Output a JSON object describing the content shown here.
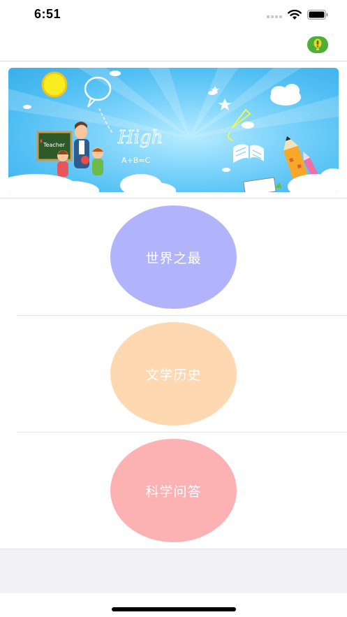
{
  "status_bar": {
    "time": "6:51"
  },
  "nav": {
    "action_icon": "exclamation-icon",
    "action_color": "#4caf38"
  },
  "banner": {
    "chalkboard_text": "Teacher",
    "sky_text_1": "High",
    "sky_text_2": "A+B=C"
  },
  "categories": [
    {
      "label": "世界之最",
      "color": "#b1b3fb"
    },
    {
      "label": "文学历史",
      "color": "#fdd8b1"
    },
    {
      "label": "科学问答",
      "color": "#fcb1b3"
    }
  ]
}
